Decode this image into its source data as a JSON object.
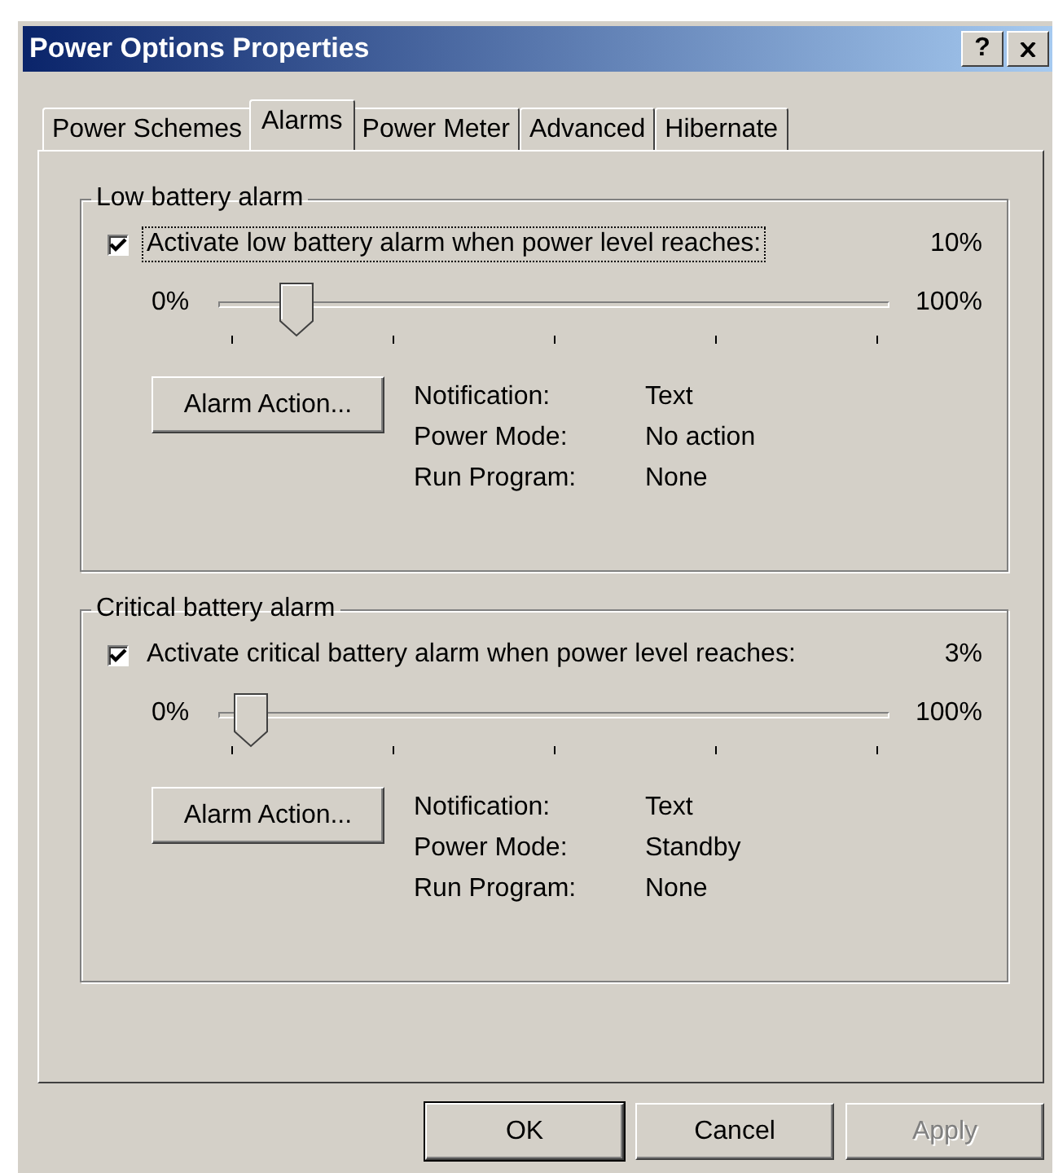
{
  "window": {
    "title": "Power Options Properties",
    "help_button": "?"
  },
  "tabs": [
    {
      "label": "Power Schemes",
      "selected": false
    },
    {
      "label": "Alarms",
      "selected": true
    },
    {
      "label": "Power Meter",
      "selected": false
    },
    {
      "label": "Advanced",
      "selected": false
    },
    {
      "label": "Hibernate",
      "selected": false
    }
  ],
  "groups": [
    {
      "legend": "Low battery alarm",
      "checkbox": {
        "label": "Activate low battery alarm when power level reaches:",
        "checked": true,
        "focused": true
      },
      "reading": "10%",
      "slider": {
        "min_label": "0%",
        "max_label": "100%",
        "level": 0.1
      },
      "action_button": "Alarm Action...",
      "details": [
        {
          "label": "Notification:",
          "value": "Text"
        },
        {
          "label": "Power Mode:",
          "value": "No action"
        },
        {
          "label": "Run Program:",
          "value": "None"
        }
      ]
    },
    {
      "legend": "Critical battery alarm",
      "checkbox": {
        "label": "Activate critical battery alarm when power level reaches:",
        "checked": true,
        "focused": false
      },
      "reading": "3%",
      "slider": {
        "min_label": "0%",
        "max_label": "100%",
        "level": 0.03
      },
      "action_button": "Alarm Action...",
      "details": [
        {
          "label": "Notification:",
          "value": "Text"
        },
        {
          "label": "Power Mode:",
          "value": "Standby"
        },
        {
          "label": "Run Program:",
          "value": "None"
        }
      ]
    }
  ],
  "buttons": [
    {
      "label": "OK",
      "disabled": false,
      "default": true
    },
    {
      "label": "Cancel",
      "disabled": false,
      "default": false
    },
    {
      "label": "Apply",
      "disabled": true,
      "default": false
    }
  ]
}
